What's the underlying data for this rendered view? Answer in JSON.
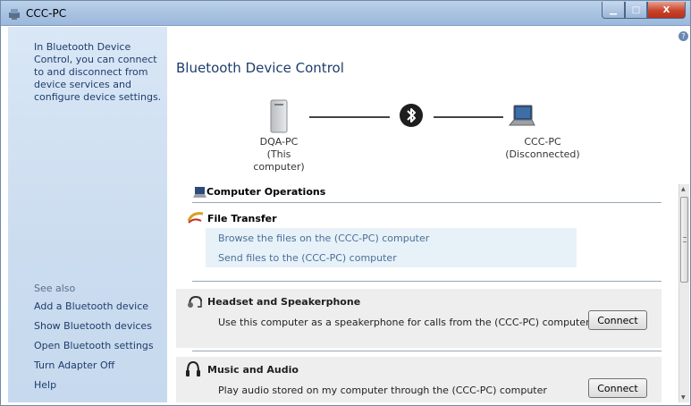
{
  "window": {
    "title": "CCC-PC"
  },
  "caption": {
    "minimize": "▁",
    "maximize": "□",
    "close": "X"
  },
  "sidebar": {
    "description": "In Bluetooth Device Control, you can connect to and disconnect from device services and configure device settings.",
    "see_also": "See also",
    "links": [
      "Add a Bluetooth device",
      "Show Bluetooth devices",
      "Open Bluetooth settings",
      "Turn Adapter Off",
      "Help"
    ]
  },
  "main": {
    "title": "Bluetooth Device Control",
    "local_device": {
      "name": "DQA-PC",
      "status": "(This computer)"
    },
    "remote_device": {
      "name": "CCC-PC",
      "status": "(Disconnected)"
    },
    "operations": {
      "header": "Computer Operations",
      "file_transfer": {
        "name": "File Transfer",
        "links": [
          "Browse the files on the (CCC-PC) computer",
          "Send files to the (CCC-PC) computer"
        ]
      },
      "services": [
        {
          "name": "Headset and Speakerphone",
          "description": "Use this computer as a speakerphone for calls from the (CCC-PC) computer",
          "button": "Connect"
        },
        {
          "name": "Music and Audio",
          "description": "Play audio stored on my computer through the (CCC-PC) computer",
          "button": "Connect"
        }
      ]
    }
  },
  "colors": {
    "accent": "#1e3d6b",
    "link": "#4b6f98",
    "sidebar_bg": "#cbdcef",
    "titlebar": "#a9c3e2",
    "close_button": "#c8432a"
  }
}
